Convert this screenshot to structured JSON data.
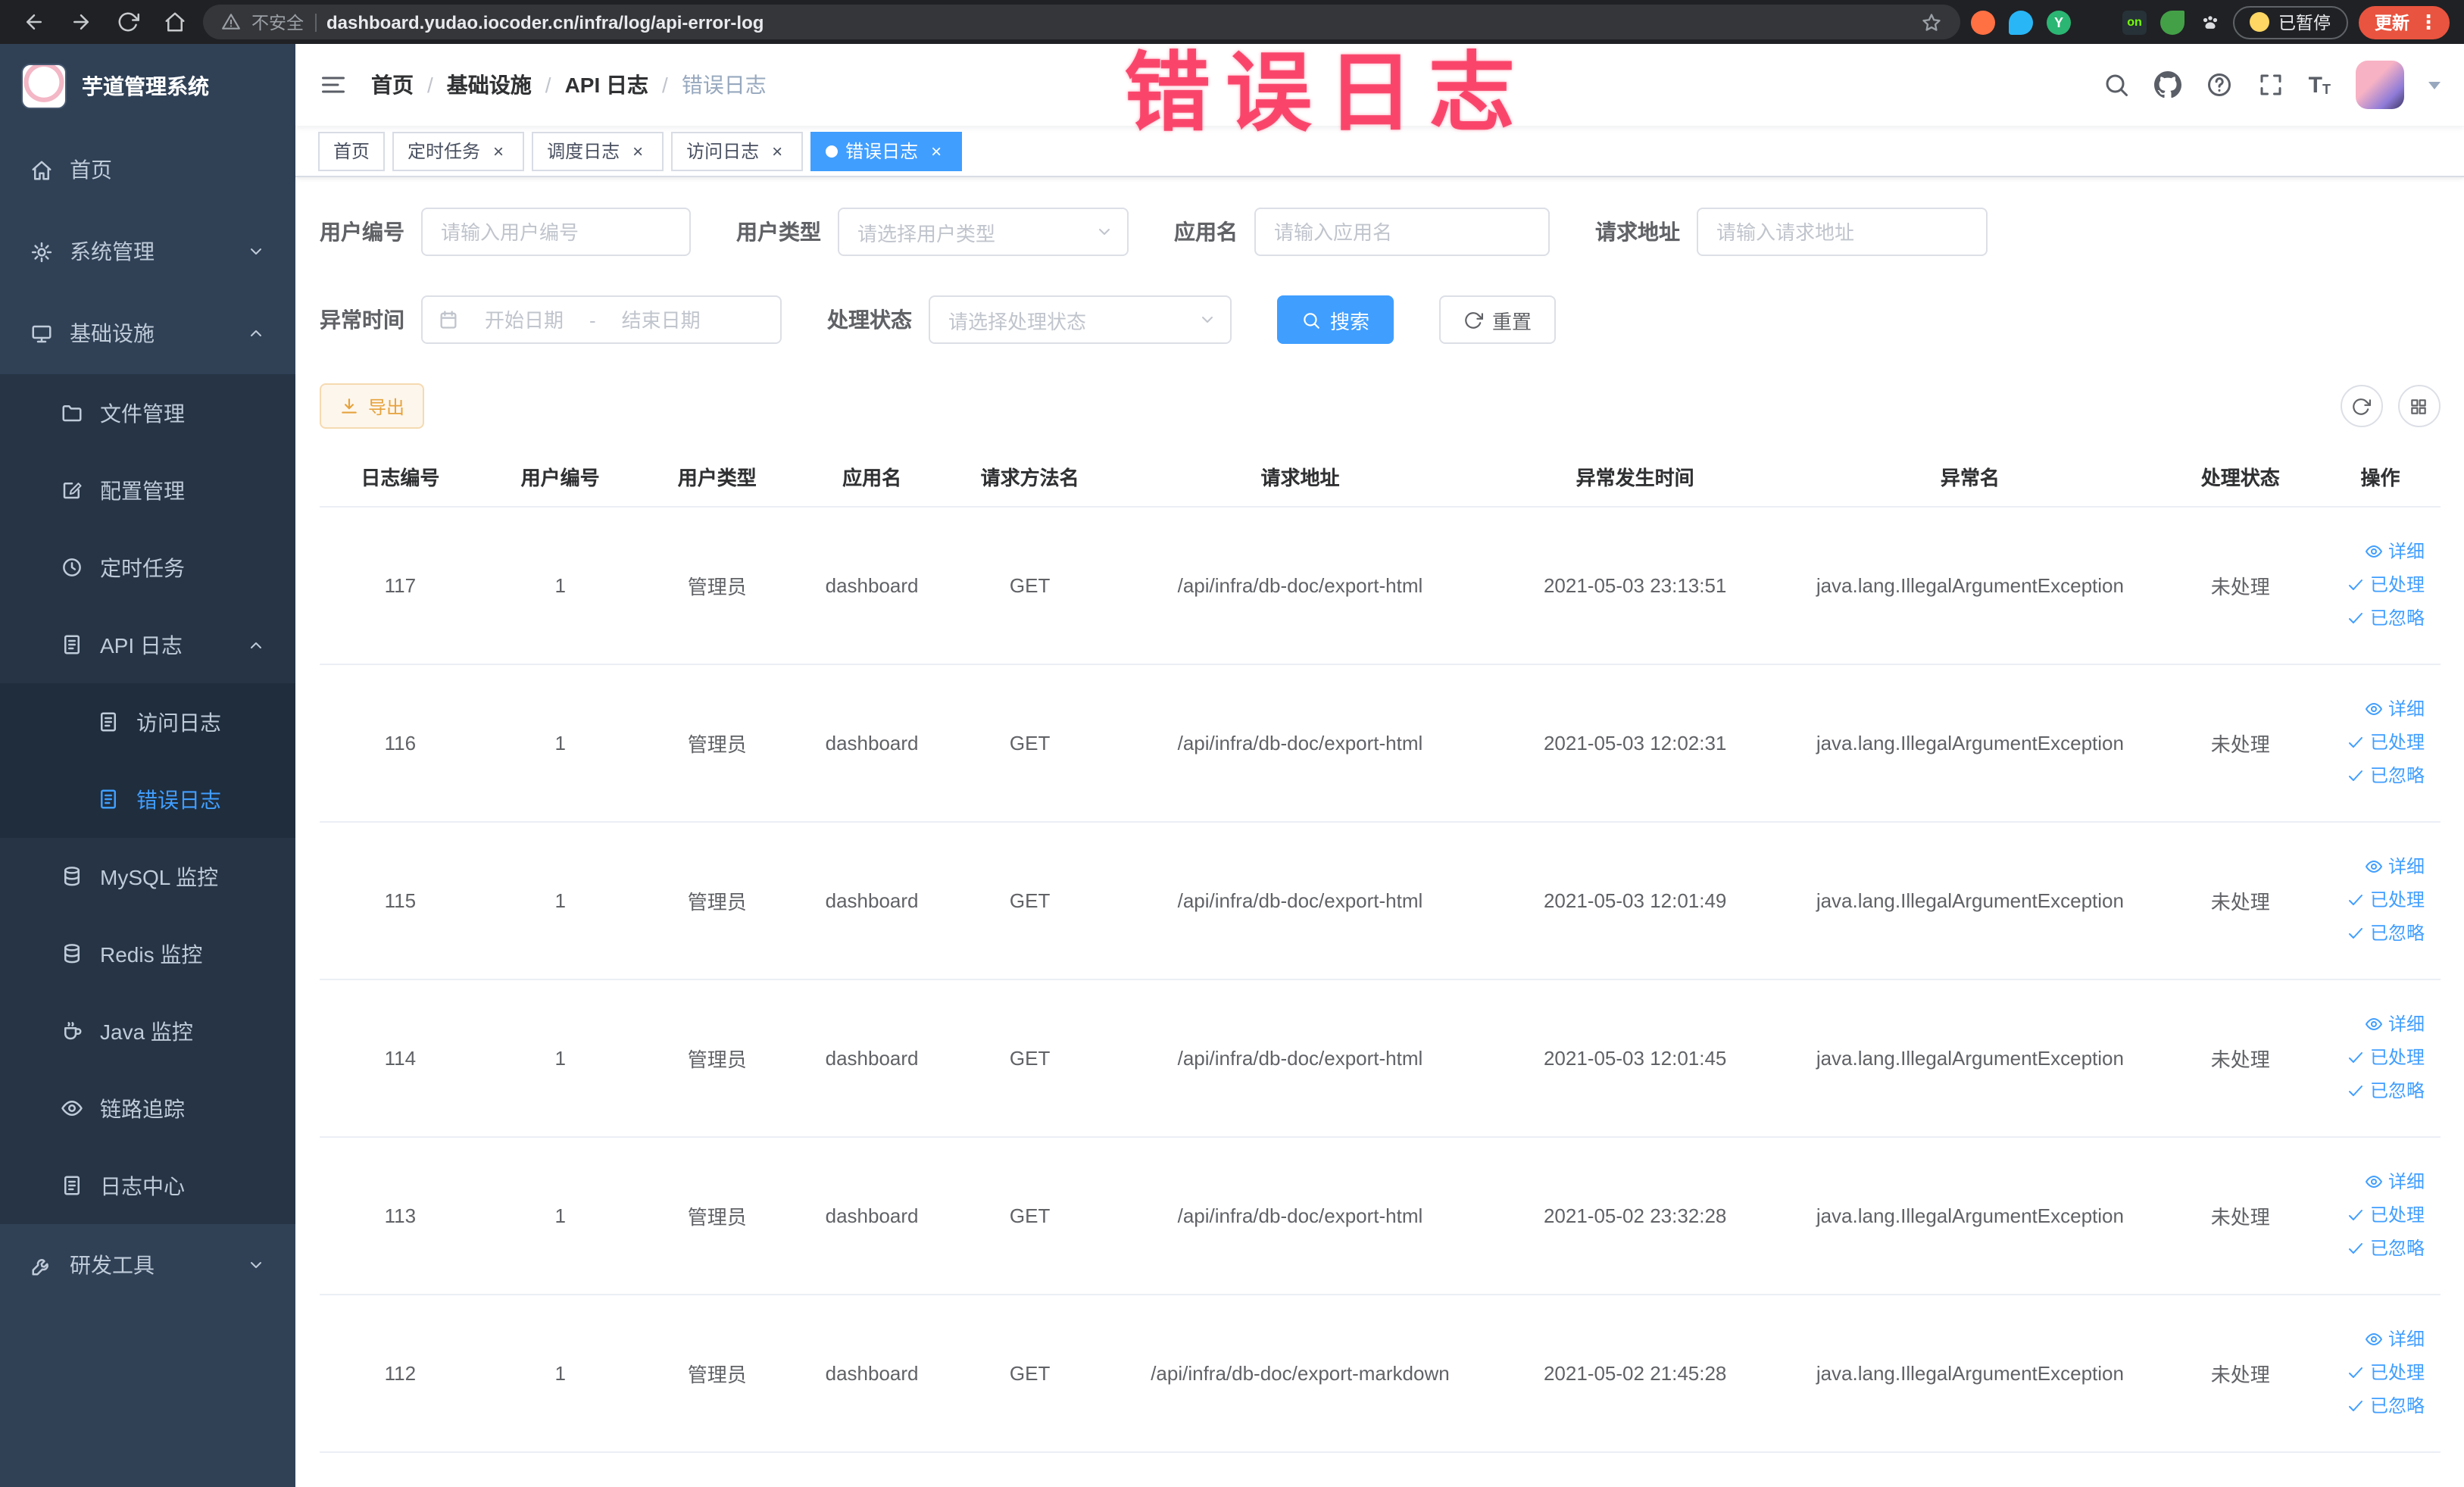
{
  "browser": {
    "security_label": "不安全",
    "url": "dashboard.yudao.iocoder.cn/infra/log/api-error-log",
    "extension_badge": "on",
    "paused_chip": "已暂停",
    "update_chip": "更新"
  },
  "annotation": {
    "text": "错误日志"
  },
  "sidebar": {
    "logo_title": "芋道管理系统",
    "items": [
      {
        "label": "首页",
        "icon": "home-icon"
      },
      {
        "label": "系统管理",
        "icon": "gear-icon",
        "has_children": true
      },
      {
        "label": "基础设施",
        "icon": "monitor-icon",
        "expanded": true,
        "children": [
          {
            "label": "文件管理",
            "icon": "folder-icon"
          },
          {
            "label": "配置管理",
            "icon": "edit-icon"
          },
          {
            "label": "定时任务",
            "icon": "clock-icon"
          },
          {
            "label": "API 日志",
            "icon": "document-icon",
            "expanded": true,
            "children": [
              {
                "label": "访问日志",
                "icon": "document-icon"
              },
              {
                "label": "错误日志",
                "icon": "document-icon",
                "active": true
              }
            ]
          },
          {
            "label": "MySQL 监控",
            "icon": "database-icon"
          },
          {
            "label": "Redis 监控",
            "icon": "database-icon"
          },
          {
            "label": "Java 监控",
            "icon": "coffee-icon"
          },
          {
            "label": "链路追踪",
            "icon": "eye-icon"
          },
          {
            "label": "日志中心",
            "icon": "document-icon"
          }
        ]
      },
      {
        "label": "研发工具",
        "icon": "wrench-icon",
        "has_children": true
      }
    ]
  },
  "header": {
    "breadcrumb": [
      "首页",
      "基础设施",
      "API 日志",
      "错误日志"
    ],
    "separator": "/"
  },
  "tabs": {
    "items": [
      {
        "label": "首页",
        "active": false,
        "closable": false
      },
      {
        "label": "定时任务",
        "active": false,
        "closable": true
      },
      {
        "label": "调度日志",
        "active": false,
        "closable": true
      },
      {
        "label": "访问日志",
        "active": false,
        "closable": true
      },
      {
        "label": "错误日志",
        "active": true,
        "closable": true
      }
    ]
  },
  "filters": {
    "user_id": {
      "label": "用户编号",
      "placeholder": "请输入用户编号",
      "value": ""
    },
    "user_type": {
      "label": "用户类型",
      "placeholder": "请选择用户类型"
    },
    "app_name": {
      "label": "应用名",
      "placeholder": "请输入应用名",
      "value": ""
    },
    "request_url": {
      "label": "请求地址",
      "placeholder": "请输入请求地址",
      "value": ""
    },
    "exception_time": {
      "label": "异常时间",
      "start_placeholder": "开始日期",
      "end_placeholder": "结束日期",
      "separator": "-"
    },
    "process_status": {
      "label": "处理状态",
      "placeholder": "请选择处理状态"
    },
    "search_label": "搜索",
    "reset_label": "重置"
  },
  "toolbar": {
    "export_label": "导出"
  },
  "table": {
    "columns": [
      "日志编号",
      "用户编号",
      "用户类型",
      "应用名",
      "请求方法名",
      "请求地址",
      "异常发生时间",
      "异常名",
      "处理状态",
      "操作"
    ],
    "actions": [
      {
        "label": "详细",
        "name": "detail-link",
        "icon": "eye-icon"
      },
      {
        "label": "已处理",
        "name": "mark-processed-link",
        "icon": "check-icon"
      },
      {
        "label": "已忽略",
        "name": "mark-ignored-link",
        "icon": "check-icon"
      }
    ],
    "rows": [
      {
        "log_id": "117",
        "user_id": "1",
        "user_type": "管理员",
        "app_name": "dashboard",
        "method": "GET",
        "url": "/api/infra/db-doc/export-html",
        "time": "2021-05-03 23:13:51",
        "exception": "java.lang.IllegalArgumentException",
        "status": "未处理"
      },
      {
        "log_id": "116",
        "user_id": "1",
        "user_type": "管理员",
        "app_name": "dashboard",
        "method": "GET",
        "url": "/api/infra/db-doc/export-html",
        "time": "2021-05-03 12:02:31",
        "exception": "java.lang.IllegalArgumentException",
        "status": "未处理"
      },
      {
        "log_id": "115",
        "user_id": "1",
        "user_type": "管理员",
        "app_name": "dashboard",
        "method": "GET",
        "url": "/api/infra/db-doc/export-html",
        "time": "2021-05-03 12:01:49",
        "exception": "java.lang.IllegalArgumentException",
        "status": "未处理"
      },
      {
        "log_id": "114",
        "user_id": "1",
        "user_type": "管理员",
        "app_name": "dashboard",
        "method": "GET",
        "url": "/api/infra/db-doc/export-html",
        "time": "2021-05-03 12:01:45",
        "exception": "java.lang.IllegalArgumentException",
        "status": "未处理"
      },
      {
        "log_id": "113",
        "user_id": "1",
        "user_type": "管理员",
        "app_name": "dashboard",
        "method": "GET",
        "url": "/api/infra/db-doc/export-html",
        "time": "2021-05-02 23:32:28",
        "exception": "java.lang.IllegalArgumentException",
        "status": "未处理"
      },
      {
        "log_id": "112",
        "user_id": "1",
        "user_type": "管理员",
        "app_name": "dashboard",
        "method": "GET",
        "url": "/api/infra/db-doc/export-markdown",
        "time": "2021-05-02 21:45:28",
        "exception": "java.lang.IllegalArgumentException",
        "status": "未处理"
      }
    ]
  },
  "colors": {
    "primary": "#409eff",
    "sidebar_bg": "#304156",
    "submenu_bg": "#263445",
    "nested_submenu_bg": "#1f2d3d",
    "warning_text": "#e6a23c",
    "annotation": "#fa3a62",
    "update_chip_bg": "#e8543f"
  }
}
